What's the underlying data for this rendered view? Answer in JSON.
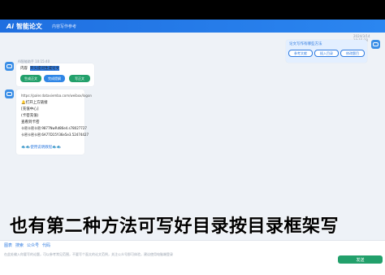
{
  "app": {
    "logo": "Ai",
    "title": "智能论文",
    "nav_label": "内容写作参考"
  },
  "user_message": {
    "timestamp": "2024/3/14 10:15:38",
    "text": "论文写作有哪些方法",
    "buttons": [
      "参考文献",
      "插入目录",
      "修改题目"
    ]
  },
  "ai_message_1": {
    "name": "AI智能助手 10:15:40",
    "prefix": "内容",
    "highlight": "开头提问生成论文",
    "buttons": [
      "生成正文",
      "完成提纲",
      "写正文"
    ]
  },
  "ai_message_2": {
    "lines": [
      "https://paler.dataxiemba.com/weibox/logon",
      "🔔打开上方链接",
      "[充值中心]",
      "(卡密充值)",
      "查看到卡密",
      "卡密卡密卡密:9877NwRd86e4.s78027727",
      "卡密卡密卡密:6A77D15Y36e5e3.52474427"
    ],
    "footer": "🐟🐟使用说明教程🐟🐟"
  },
  "caption": "也有第二种方法可写好目录按目录框架写",
  "input": {
    "tools": [
      "图表",
      "搜索",
      "公众号",
      "代码"
    ],
    "placeholder": "在此处输入你要写的论题，可以参考常见范围，不要写个面太的论文范例，关注公众号即可体验，建议使用电脑端登录",
    "send_label": "发送"
  }
}
